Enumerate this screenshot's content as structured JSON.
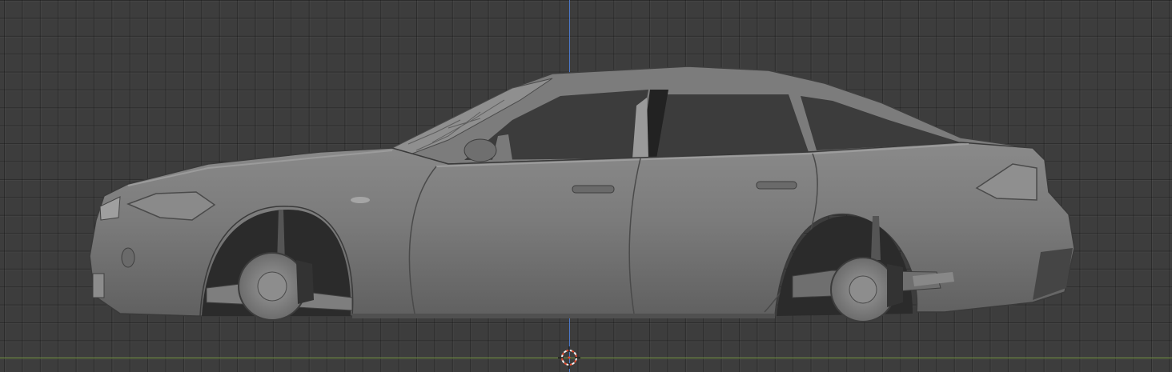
{
  "viewport": {
    "view": "side-orthographic",
    "grid_visible": true,
    "axes": {
      "z_axis_color": "#4b78c8",
      "y_axis_color": "#7ea04a"
    },
    "background_color": "#3d3d3d",
    "object": {
      "name": "car-body-mesh",
      "shading": "solid",
      "color": "#7a7a7a"
    },
    "cursor": {
      "icon": "3d-cursor-icon",
      "ring_colors": [
        "#e04a2e",
        "#f2f2f2"
      ]
    }
  }
}
